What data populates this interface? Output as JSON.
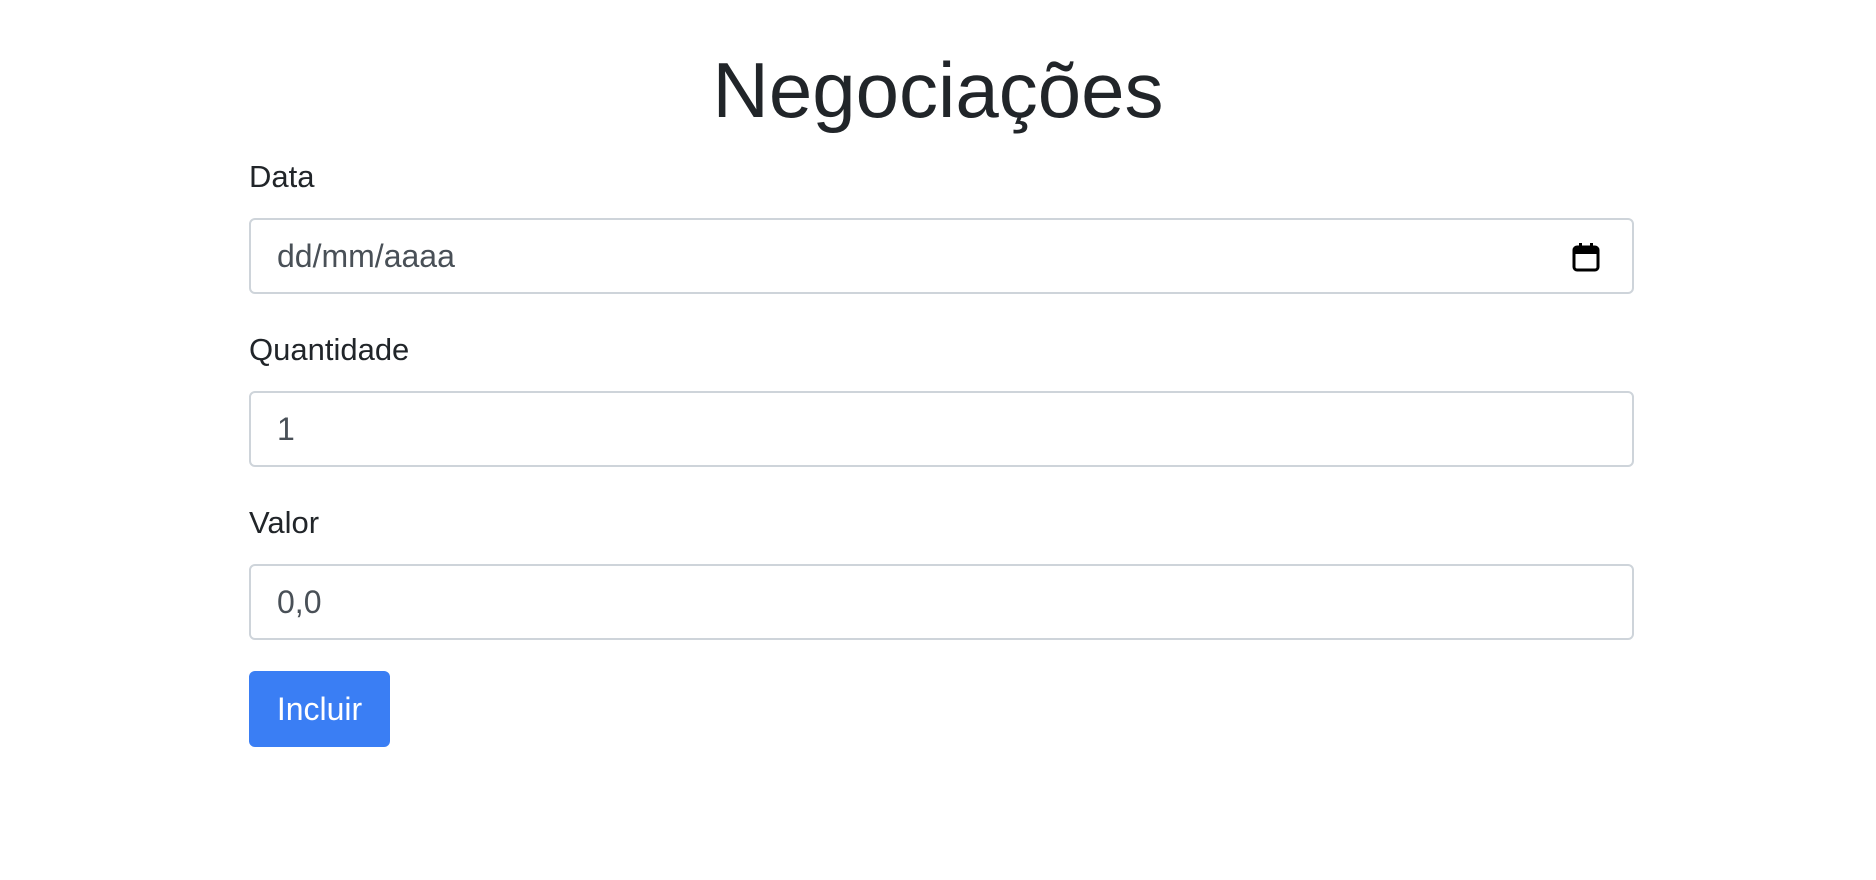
{
  "page": {
    "title": "Negociações"
  },
  "form": {
    "data": {
      "label": "Data",
      "placeholder": "dd/mm/aaaa",
      "icon": "calendar-icon"
    },
    "quantidade": {
      "label": "Quantidade",
      "value": "1"
    },
    "valor": {
      "label": "Valor",
      "value": "0,0"
    },
    "submit_label": "Incluir"
  },
  "colors": {
    "primary": "#3a7ef4",
    "text": "#212529",
    "input_border": "#ced4da",
    "input_text": "#495057"
  }
}
